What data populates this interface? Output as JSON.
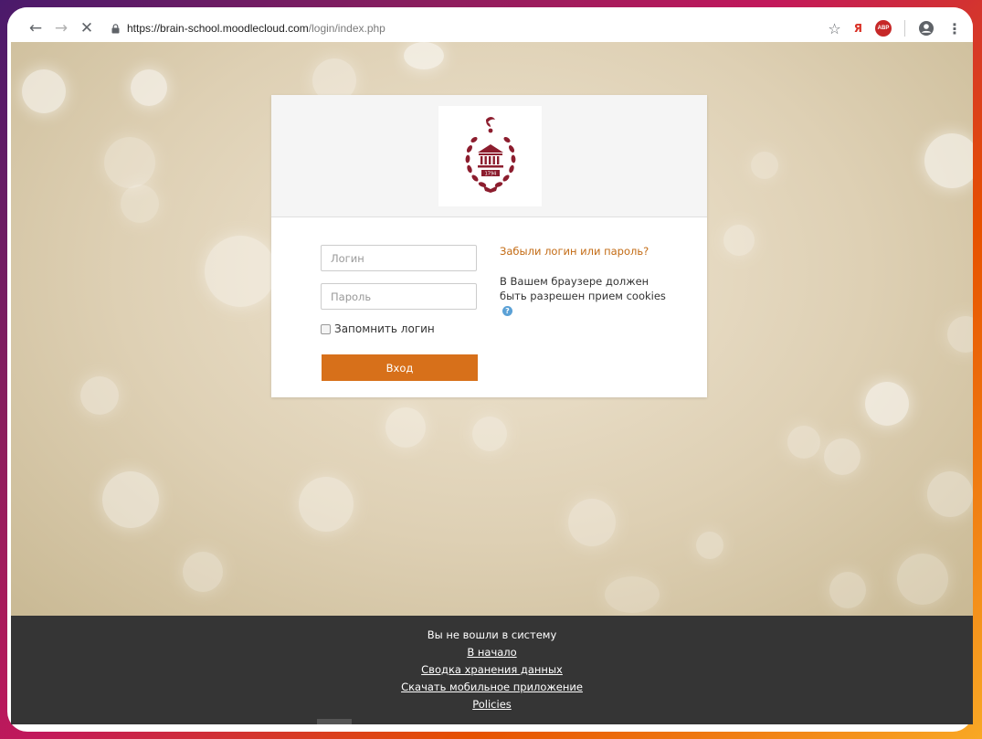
{
  "browser": {
    "url_host": "https://brain-school.moodlecloud.com",
    "url_path": "/login/index.php",
    "icons": {
      "back": "arrow-left-icon",
      "forward": "arrow-right-icon",
      "stop": "close-icon",
      "lock": "lock-icon",
      "bookmark": "star-icon",
      "extension": "yandex-icon",
      "adblock": "adblock-icon",
      "account": "account-icon",
      "menu": "more-vert-icon"
    },
    "adblock_label": "ABP"
  },
  "login": {
    "username_placeholder": "Логин",
    "password_placeholder": "Пароль",
    "remember_label": "Запомнить логин",
    "submit_label": "Вход",
    "forgot_link": "Забыли логин или пароль?",
    "cookies_notice": "В Вашем браузере должен быть разрешен прием cookies",
    "logo_year": "1794",
    "accent_color": "#d7701a"
  },
  "footer": {
    "status": "Вы не вошли в систему",
    "links": [
      "В начало",
      "Сводка хранения данных",
      "Скачать мобильное приложение",
      "Policies"
    ]
  }
}
